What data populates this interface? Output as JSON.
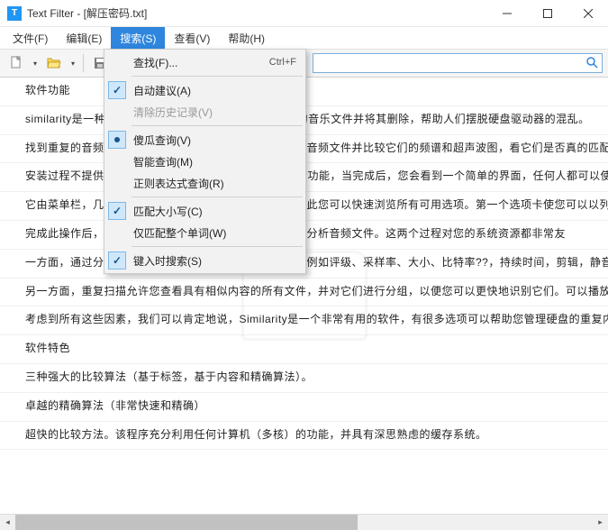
{
  "title": "Text Filter - [解压密码.txt]",
  "appicon_letter": "T",
  "menubar": {
    "file": "文件(F)",
    "edit": "编辑(E)",
    "search": "搜索(S)",
    "view": "查看(V)",
    "help": "帮助(H)"
  },
  "dropdown": {
    "find": "查找(F)...",
    "find_shortcut": "Ctrl+F",
    "autosuggest": "自动建议(A)",
    "clear_history": "清除历史记录(V)",
    "dumb_query": "傻瓜查询(V)",
    "smart_query": "智能查询(M)",
    "regex_query": "正则表达式查询(R)",
    "match_case": "匹配大小写(C)",
    "whole_word": "仅匹配整个单词(W)",
    "search_on_type": "键入时搜索(S)"
  },
  "search_placeholder": "",
  "lines": [
    "软件功能",
    "similarity是一种免费的软件工具，它可以使您查找相似的音乐文件并将其删除，帮助人们摆脱硬盘驱动器的混乱。",
    "找到重复的音频文件，并让您选择在计算机上扫描重复的音频文件并比较它们的频谱和超声波图，看它们是否真的匹配。",
    "安装过程不提供任何工具栏，功能或更改Web浏览器中的功能，当完成后，您会看到一个简单的界面，任何人都可以使用，即使",
    "它由菜单栏，几个快捷按钮和一个选项卡式面板组成，因此您可以快速浏览所有可用选项。第一个选项卡使您可以以列表和",
    "完成此操作后，您可以在相同面板中显示所有重复项，或分析音频文件。这两个过程对您的系统资源都非常友",
    "一方面，通过分析，您可以查看有关歌曲和视频的信息，例如评级、采样率、大小、比特率??，持续时间，剪辑，静音",
    "另一方面，重复扫描允许您查看具有相似内容的所有文件，并对它们进行分组，以便您可以更快地识别它们。可以播放",
    "考虑到所有这些因素，我们可以肯定地说，Similarity是一个非常有用的软件，有很多选项可以帮助您管理硬盘的重复内",
    "软件特色",
    "三种强大的比较算法（基于标签，基于内容和精确算法）。",
    "卓越的精确算法（非常快速和精确）",
    "超快的比较方法。该程序充分利用任何计算机（多核）的功能，并具有深思熟虑的缓存系统。"
  ]
}
